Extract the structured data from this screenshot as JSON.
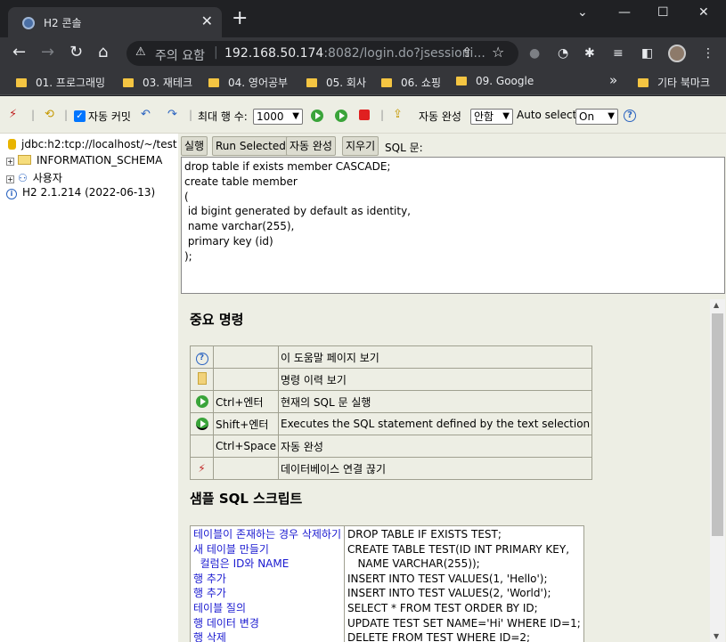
{
  "browser": {
    "tab_title": "H2 콘솔",
    "tab_close": "✕",
    "new_tab": "+",
    "security_label": "주의 요함",
    "url_host": "192.168.50.174",
    "url_rest": ":8082/login.do?jsessioni...",
    "bookmarks": [
      "01. 프로그래밍",
      "03. 재테크",
      "04. 영어공부",
      "05. 회사",
      "06. 쇼핑",
      "09. Google"
    ],
    "bookmarks_overflow": "»",
    "other_bookmarks": "기타 북마크"
  },
  "toolbar": {
    "auto_commit": "자동 커밋",
    "max_rows_label": "최대 행 수:",
    "max_rows_value": "1000",
    "auto_complete_label": "자동 완성",
    "auto_complete_value": "안함",
    "auto_select_label": "Auto select",
    "auto_select_value": "On"
  },
  "tree": {
    "connection": "jdbc:h2:tcp://localhost/~/test",
    "schema": "INFORMATION_SCHEMA",
    "users": "사용자",
    "version": "H2 2.1.214 (2022-06-13)"
  },
  "sql_panel": {
    "run_button": "실행",
    "run_selected_button": "Run Selected",
    "auto_complete_button": "자동 완성",
    "clear_button": "지우기",
    "sql_label": "SQL 문:",
    "editor_text": "drop table if exists member CASCADE;\ncreate table member\n(\n id bigint generated by default as identity,\n name varchar(255),\n primary key (id)\n);"
  },
  "help": {
    "important_title": "중요 명령",
    "commands": [
      {
        "icon": "help-icon",
        "key": "",
        "desc": "이 도움말 페이지 보기"
      },
      {
        "icon": "history-icon",
        "key": "",
        "desc": "명령 이력 보기"
      },
      {
        "icon": "run-icon",
        "key": "Ctrl+엔터",
        "desc": "현재의 SQL 문 실행"
      },
      {
        "icon": "run-selected-icon",
        "key": "Shift+엔터",
        "desc": "Executes the SQL statement defined by the text selection"
      },
      {
        "icon": "",
        "key": "Ctrl+Space",
        "desc": "자동 완성"
      },
      {
        "icon": "disconnect-icon",
        "key": "",
        "desc": "데이터베이스 연결 끊기"
      }
    ],
    "sample_title": "샘플 SQL 스크립트",
    "sample_links": [
      "테이블이 존재하는 경우 삭제하기",
      "새 테이블 만들기",
      "  컬럼은 ID와 NAME",
      "행 추가",
      "행 추가",
      "테이블 질의",
      "행 데이터 변경",
      "행 삭제"
    ],
    "sample_code": [
      "DROP TABLE IF EXISTS TEST;",
      "CREATE TABLE TEST(ID INT PRIMARY KEY,",
      "   NAME VARCHAR(255));",
      "INSERT INTO TEST VALUES(1, 'Hello');",
      "INSERT INTO TEST VALUES(2, 'World');",
      "SELECT * FROM TEST ORDER BY ID;",
      "UPDATE TEST SET NAME='Hi' WHERE ID=1;",
      "DELETE FROM TEST WHERE ID=2;"
    ]
  }
}
